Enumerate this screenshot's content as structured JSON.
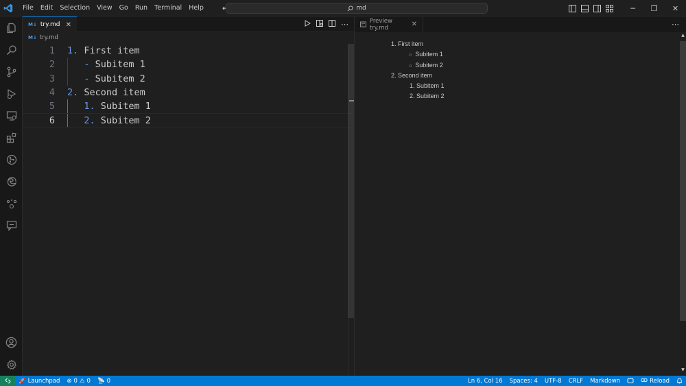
{
  "menu": [
    "File",
    "Edit",
    "Selection",
    "View",
    "Go",
    "Run",
    "Terminal",
    "Help"
  ],
  "search": {
    "text": "md"
  },
  "window_controls": {
    "minimize": "─",
    "restore": "❐",
    "close": "✕"
  },
  "left_tab": {
    "badge": "M↓",
    "label": "try.md",
    "close": "✕"
  },
  "breadcrumb": {
    "badge": "M↓",
    "label": "try.md"
  },
  "code_lines": [
    {
      "n": "1",
      "marker": "1.",
      "text": " First item",
      "indent": ""
    },
    {
      "n": "2",
      "marker": "-",
      "text": " Subitem 1",
      "indent": "   "
    },
    {
      "n": "3",
      "marker": "-",
      "text": " Subitem 2",
      "indent": "   "
    },
    {
      "n": "4",
      "marker": "2.",
      "text": " Second item",
      "indent": ""
    },
    {
      "n": "5",
      "marker": "1.",
      "text": " Subitem 1",
      "indent": "   "
    },
    {
      "n": "6",
      "marker": "2.",
      "text": " Subitem 2",
      "indent": "   "
    }
  ],
  "preview_tab": {
    "label": "Preview try.md",
    "close": "✕"
  },
  "preview": {
    "items": [
      {
        "marker": "1.",
        "text": "First item"
      },
      {
        "marker": "○",
        "text": "Subitem 1"
      },
      {
        "marker": "○",
        "text": "Subitem 2"
      },
      {
        "marker": "2.",
        "text": "Second item"
      },
      {
        "marker": "1.",
        "text": "Subitem 1"
      },
      {
        "marker": "2.",
        "text": "Subitem 2"
      }
    ]
  },
  "status": {
    "launchpad": "Launchpad",
    "errors": "0",
    "warnings": "0",
    "ports": "0",
    "position": "Ln 6, Col 16",
    "spaces": "Spaces: 4",
    "encoding": "UTF-8",
    "eol": "CRLF",
    "language": "Markdown",
    "reload": "Reload"
  },
  "colors": {
    "accent": "#0078d4",
    "remote": "#16825d",
    "list_number": "#6796e6"
  }
}
